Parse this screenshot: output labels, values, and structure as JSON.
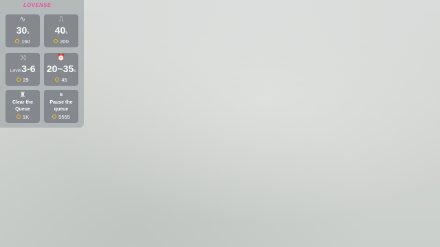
{
  "brand": {
    "name": "LOVENSE"
  },
  "cards": [
    {
      "icon": "wave-icon",
      "icon_glyph": "∿",
      "prefix": "",
      "value": "30",
      "unit": "s",
      "price": "160"
    },
    {
      "icon": "pulse-icon",
      "icon_glyph": "⎍",
      "prefix": "",
      "value": "40",
      "unit": "s",
      "price": "200"
    },
    {
      "icon": "shuffle-icon",
      "icon_glyph": "⤨",
      "prefix": "Level",
      "value": "3-6",
      "unit": "",
      "price": "29"
    },
    {
      "icon": "alarm-icon",
      "icon_glyph": "⏰",
      "prefix": "",
      "value": "20~35",
      "unit": "s",
      "price": "45"
    },
    {
      "icon": "clear-queue-icon",
      "icon_glyph": "♜",
      "label_line1": "Clear the",
      "label_line2": "Queue",
      "price": "1K"
    },
    {
      "icon": "pause-icon",
      "icon_glyph": "⏸",
      "label_line1": "Pause the",
      "label_line2": "queue",
      "price": "5555"
    }
  ],
  "colors": {
    "brand": "#e8589b",
    "coin": "#f2c21b",
    "panel": "#969ca0",
    "card": "#767a80"
  }
}
